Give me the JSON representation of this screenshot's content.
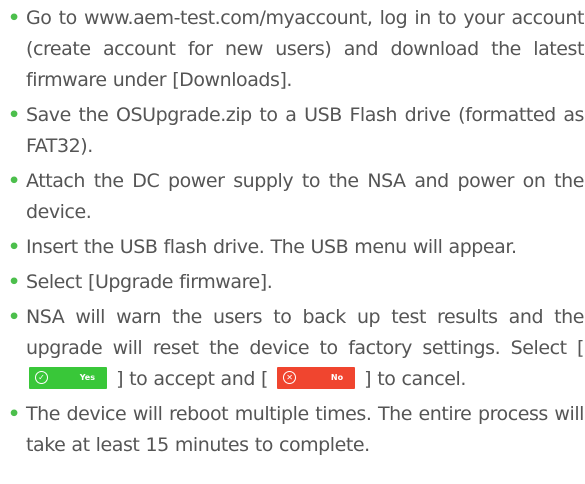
{
  "steps": [
    {
      "text": "Go to www.aem-test.com/myaccount, log in to your account (create account for new users) and download the latest firmware under [Downloads]."
    },
    {
      "text": "Save the OSUpgrade.zip to a USB Flash drive (formatted as FAT32)."
    },
    {
      "text": "Attach the DC power supply to the NSA and power on the device."
    },
    {
      "text": "Insert the USB flash drive. The USB menu will appear."
    },
    {
      "text": "Select [Upgrade firmware]."
    },
    {
      "text_before": "NSA will warn the users to back up test results and the upgrade will reset the device to factory settings. Select [",
      "yes_button": {
        "label": "Yes",
        "icon": "check-circle-icon",
        "color": "#39c739"
      },
      "text_middle": "] to accept and [",
      "no_button": {
        "label": "No",
        "icon": "x-circle-icon",
        "color": "#f0452f"
      },
      "text_after": "] to cancel."
    },
    {
      "text": "The device will reboot multiple times. The entire process will take at least 15 minutes to complete."
    }
  ],
  "bullet": "•",
  "colors": {
    "bullet": "#4cbf4c",
    "text": "#555555"
  }
}
